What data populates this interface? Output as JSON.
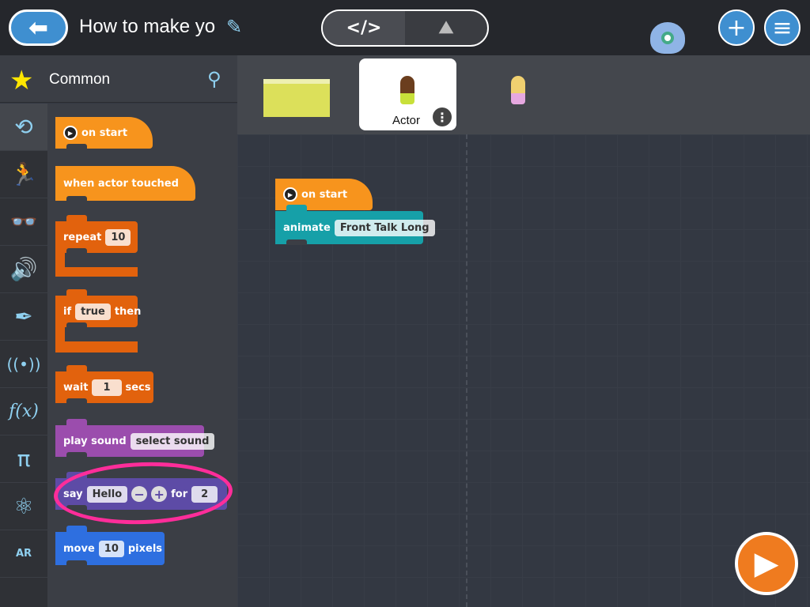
{
  "header": {
    "title": "How to make yo",
    "back_icon": "arrow-left-icon",
    "edit_icon": "pencil-icon",
    "code_tab_label": "</>",
    "scene_tab_icon": "image-icon",
    "add_icon": "+",
    "menu_icon": "≡"
  },
  "palette": {
    "category": "Common",
    "category_icon": "star-icon",
    "search_icon": "search-icon",
    "categories": [
      "loop",
      "motion",
      "looks",
      "sound",
      "pen",
      "broadcast",
      "f(x)",
      "π",
      "science",
      "AR"
    ]
  },
  "stage": {
    "actor_name": "Actor",
    "menu_icon": "⋮"
  },
  "blocks": {
    "on_start": "on start",
    "when_touched": "when actor touched",
    "repeat": {
      "label": "repeat",
      "value": "10"
    },
    "if": {
      "label": "if",
      "value": "true",
      "then": "then"
    },
    "wait": {
      "label": "wait",
      "value": "1",
      "unit": "secs"
    },
    "play_sound": {
      "label": "play sound",
      "value": "select sound"
    },
    "say": {
      "label": "say",
      "value": "Hello",
      "minus": "−",
      "plus": "+",
      "for": "for",
      "secs": "2"
    },
    "move": {
      "label": "move",
      "value": "10",
      "unit": "pixels"
    }
  },
  "canvas": {
    "on_start": "on start",
    "animate": {
      "label": "animate",
      "value": "Front Talk Long"
    }
  },
  "colors": {
    "orange": "#f7941d",
    "dark_orange": "#e2620d",
    "purple": "#9b4dad",
    "say_purple": "#5d4ba6",
    "blue": "#2e6fe0",
    "teal": "#16a0a8",
    "highlight": "#ff2d9a"
  }
}
